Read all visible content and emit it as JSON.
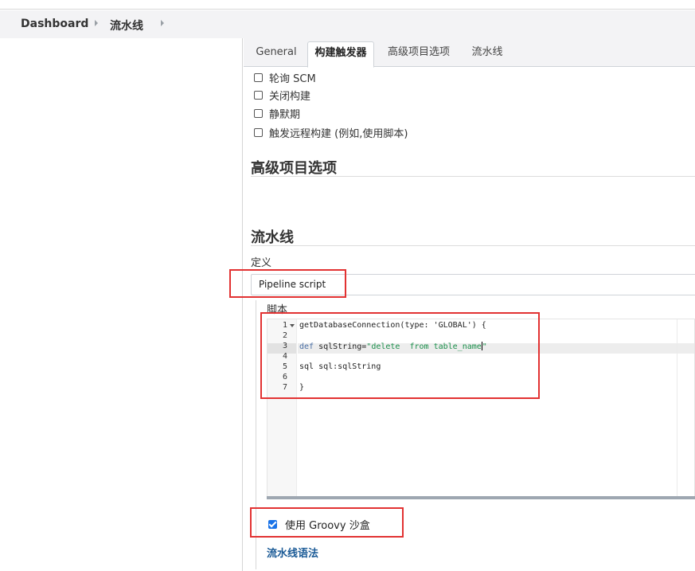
{
  "breadcrumb": {
    "items": [
      "Dashboard",
      "流水线"
    ]
  },
  "tabs": [
    {
      "label": "General",
      "active": false
    },
    {
      "label": "构建触发器",
      "active": true
    },
    {
      "label": "高级项目选项",
      "active": false
    },
    {
      "label": "流水线",
      "active": false
    }
  ],
  "triggers": [
    {
      "label": "轮询 SCM",
      "checked": false
    },
    {
      "label": "关闭构建",
      "checked": false
    },
    {
      "label": "静默期",
      "checked": false
    },
    {
      "label": "触发远程构建 (例如,使用脚本)",
      "checked": false
    }
  ],
  "advanced": {
    "title": "高级项目选项"
  },
  "pipeline": {
    "title": "流水线",
    "definition_label": "定义",
    "definition_value": "Pipeline script",
    "script_label": "脚本",
    "code_lines": [
      {
        "num": "1",
        "text": "getDatabaseConnection(type: 'GLOBAL') {"
      },
      {
        "num": "2",
        "text": ""
      },
      {
        "num": "3",
        "text": "def sqlString=\"delete  from table_name\""
      },
      {
        "num": "4",
        "text": ""
      },
      {
        "num": "5",
        "text": "sql sql:sqlString"
      },
      {
        "num": "6",
        "text": ""
      },
      {
        "num": "7",
        "text": "}"
      }
    ],
    "active_line": 3,
    "groovy_sandbox_label": "使用 Groovy 沙盒",
    "groovy_sandbox_checked": true,
    "syntax_link": "流水线语法"
  },
  "colors": {
    "highlight_box": "#e23232",
    "link": "#1a5a96",
    "checkbox_checked": "#1a73e8"
  }
}
